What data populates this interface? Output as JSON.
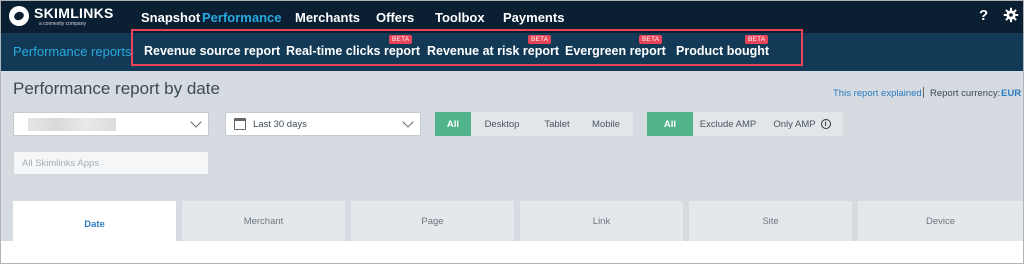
{
  "brand": {
    "name": "SKIMLINKS",
    "tagline": "a connexity company"
  },
  "topnav": {
    "items": [
      {
        "label": "Snapshot",
        "active": false
      },
      {
        "label": "Performance",
        "active": true
      },
      {
        "label": "Merchants",
        "active": false
      },
      {
        "label": "Offers",
        "active": false
      },
      {
        "label": "Toolbox",
        "active": false
      },
      {
        "label": "Payments",
        "active": false
      }
    ],
    "help": "?"
  },
  "subnav": {
    "items": [
      {
        "label": "Performance reports",
        "beta": ""
      },
      {
        "label": "Revenue source report",
        "beta": ""
      },
      {
        "label": "Real-time clicks report",
        "beta": "BETA"
      },
      {
        "label": "Revenue at risk report",
        "beta": "BETA"
      },
      {
        "label": "Evergreen report",
        "beta": "BETA"
      },
      {
        "label": "Product bought",
        "beta": "BETA"
      }
    ]
  },
  "page": {
    "title": "Performance report by date",
    "explained": "This report explained",
    "separator": "|",
    "currency_label": "Report currency:",
    "currency_value": "EUR"
  },
  "filters": {
    "date_range": "Last 30 days",
    "apps_placeholder": "All Skimlinks Apps",
    "device": [
      "All",
      "Desktop",
      "Tablet",
      "Mobile"
    ],
    "amp": [
      "All",
      "Exclude AMP",
      "Only AMP"
    ]
  },
  "tabs": [
    "Date",
    "Merchant",
    "Page",
    "Link",
    "Site",
    "Device"
  ],
  "colors": {
    "nav_bg": "#0b1f33",
    "subnav_bg": "#123a56",
    "accent": "#29a9e0",
    "toggle_on": "#52b48a",
    "beta": "#e8455a"
  }
}
